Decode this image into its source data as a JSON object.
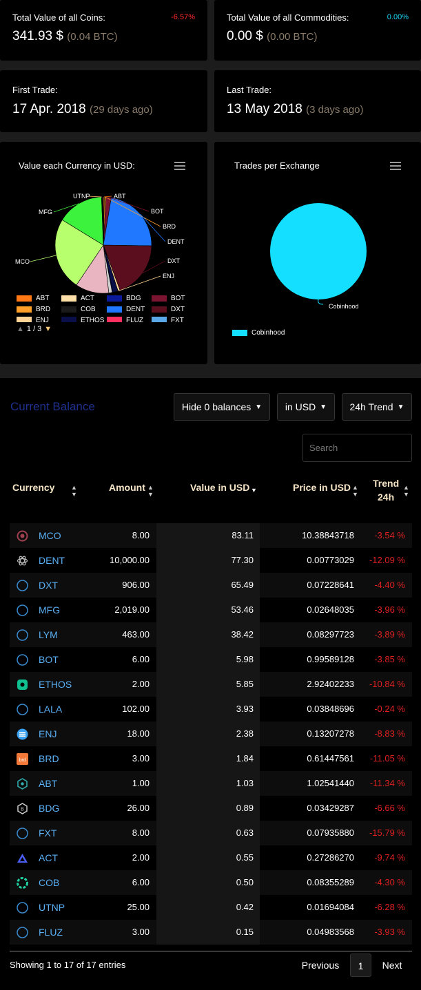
{
  "stats": {
    "total_coins": {
      "label": "Total Value of all Coins:",
      "pct": "-6.57%",
      "pct_color": "#ff2a2a",
      "value": "341.93 $",
      "sub": "(0.04 BTC)"
    },
    "total_commodities": {
      "label": "Total Value of all Commodities:",
      "pct": "0.00%",
      "pct_color": "#1fd7f5",
      "value": "0.00 $",
      "sub": "(0.00 BTC)"
    },
    "first_trade": {
      "label": "First Trade:",
      "value": "17 Apr. 2018",
      "sub": "(29 days ago)"
    },
    "last_trade": {
      "label": "Last Trade:",
      "value": "13 May 2018",
      "sub": "(3 days ago)"
    }
  },
  "chart_data": [
    {
      "type": "pie",
      "title": "Value each Currency in USD:",
      "slice_labels": [
        "UTNP",
        "ABT",
        "BOT",
        "BRD",
        "DENT",
        "DXT",
        "ENJ",
        "MCO",
        "MFG"
      ],
      "categories": [
        "MCO",
        "DENT",
        "DXT",
        "MFG",
        "LYM",
        "BOT",
        "ETHOS",
        "LALA",
        "ENJ",
        "BRD",
        "ABT",
        "BDG",
        "FXT",
        "ACT",
        "COB",
        "UTNP",
        "FLUZ"
      ],
      "values": [
        83.11,
        77.3,
        65.49,
        53.46,
        38.42,
        5.98,
        5.85,
        3.93,
        2.38,
        1.84,
        1.03,
        0.89,
        0.63,
        0.55,
        0.5,
        0.42,
        0.15
      ],
      "colors": {
        "MCO": "#b8ff6e",
        "DENT": "#1f78ff",
        "DXT": "#5a0e1e",
        "MFG": "#3cf23c",
        "LYM": "#e8b5c0",
        "BOT": "#7a1430",
        "ETHOS": "#0a0f4a",
        "LALA": "#d0d0d0",
        "ENJ": "#ffd494",
        "BRD": "#ff9f2a",
        "ABT": "#ff7814",
        "BDG": "#0a1a9a",
        "FXT": "#5aa8e8",
        "ACT": "#ffe0a8",
        "COB": "#1a1a1a",
        "UTNP": "#ffb070",
        "FLUZ": "#ff3060"
      },
      "legend": [
        {
          "label": "ABT",
          "color": "#ff7814"
        },
        {
          "label": "ACT",
          "color": "#ffe0a8"
        },
        {
          "label": "BDG",
          "color": "#0a1a9a"
        },
        {
          "label": "BOT",
          "color": "#7a1430"
        },
        {
          "label": "BRD",
          "color": "#ff9f2a"
        },
        {
          "label": "COB",
          "color": "#1a1a1a"
        },
        {
          "label": "DENT",
          "color": "#1f78ff"
        },
        {
          "label": "DXT",
          "color": "#5a0e1e"
        },
        {
          "label": "ENJ",
          "color": "#ffd494"
        },
        {
          "label": "ETHOS",
          "color": "#0a0f4a"
        },
        {
          "label": "FLUZ",
          "color": "#ff3060"
        },
        {
          "label": "FXT",
          "color": "#5aa8e8"
        }
      ],
      "legend_page": "1 / 3"
    },
    {
      "type": "pie",
      "title": "Trades per Exchange",
      "categories": [
        "Cobinhood"
      ],
      "values": [
        1
      ],
      "colors": {
        "Cobinhood": "#14dfff"
      },
      "legend": [
        {
          "label": "Cobinhood",
          "color": "#14dfff"
        }
      ]
    }
  ],
  "balance": {
    "title": "Current Balance",
    "hide_zero": "Hide 0 balances",
    "currency_unit": "in USD",
    "trend": "24h Trend",
    "search_placeholder": "Search",
    "columns": {
      "currency": "Currency",
      "amount": "Amount",
      "value": "Value in USD",
      "price": "Price in USD",
      "trend_1": "Trend",
      "trend_2": "24h"
    },
    "rows": [
      {
        "symbol": "MCO",
        "amount": "8.00",
        "value": "83.11",
        "price": "10.38843718",
        "trend": "-3.54 %",
        "icon": "mco-icon"
      },
      {
        "symbol": "DENT",
        "amount": "10,000.00",
        "value": "77.30",
        "price": "0.00773029",
        "trend": "-12.09 %",
        "icon": "dent-icon"
      },
      {
        "symbol": "DXT",
        "amount": "906.00",
        "value": "65.49",
        "price": "0.07228641",
        "trend": "-4.40 %",
        "icon": "circle-icon"
      },
      {
        "symbol": "MFG",
        "amount": "2,019.00",
        "value": "53.46",
        "price": "0.02648035",
        "trend": "-3.96 %",
        "icon": "circle-icon"
      },
      {
        "symbol": "LYM",
        "amount": "463.00",
        "value": "38.42",
        "price": "0.08297723",
        "trend": "-3.89 %",
        "icon": "circle-icon"
      },
      {
        "symbol": "BOT",
        "amount": "6.00",
        "value": "5.98",
        "price": "0.99589128",
        "trend": "-3.85 %",
        "icon": "circle-icon"
      },
      {
        "symbol": "ETHOS",
        "amount": "2.00",
        "value": "5.85",
        "price": "2.92402233",
        "trend": "-10.84 %",
        "icon": "ethos-icon"
      },
      {
        "symbol": "LALA",
        "amount": "102.00",
        "value": "3.93",
        "price": "0.03848696",
        "trend": "-0.24 %",
        "icon": "circle-icon"
      },
      {
        "symbol": "ENJ",
        "amount": "18.00",
        "value": "2.38",
        "price": "0.13207278",
        "trend": "-8.83 %",
        "icon": "enj-icon"
      },
      {
        "symbol": "BRD",
        "amount": "3.00",
        "value": "1.84",
        "price": "0.61447561",
        "trend": "-11.05 %",
        "icon": "brd-icon"
      },
      {
        "symbol": "ABT",
        "amount": "1.00",
        "value": "1.03",
        "price": "1.02541440",
        "trend": "-11.34 %",
        "icon": "abt-icon"
      },
      {
        "symbol": "BDG",
        "amount": "26.00",
        "value": "0.89",
        "price": "0.03429287",
        "trend": "-6.66 %",
        "icon": "bdg-icon"
      },
      {
        "symbol": "FXT",
        "amount": "8.00",
        "value": "0.63",
        "price": "0.07935880",
        "trend": "-15.79 %",
        "icon": "circle-icon"
      },
      {
        "symbol": "ACT",
        "amount": "2.00",
        "value": "0.55",
        "price": "0.27286270",
        "trend": "-9.74 %",
        "icon": "act-icon"
      },
      {
        "symbol": "COB",
        "amount": "6.00",
        "value": "0.50",
        "price": "0.08355289",
        "trend": "-4.30 %",
        "icon": "cob-icon"
      },
      {
        "symbol": "UTNP",
        "amount": "25.00",
        "value": "0.42",
        "price": "0.01694084",
        "trend": "-6.28 %",
        "icon": "circle-icon"
      },
      {
        "symbol": "FLUZ",
        "amount": "3.00",
        "value": "0.15",
        "price": "0.04983568",
        "trend": "-3.93 %",
        "icon": "circle-icon"
      }
    ],
    "info": "Showing 1 to 17 of 17 entries",
    "pagination": {
      "previous": "Previous",
      "page": "1",
      "next": "Next"
    }
  }
}
